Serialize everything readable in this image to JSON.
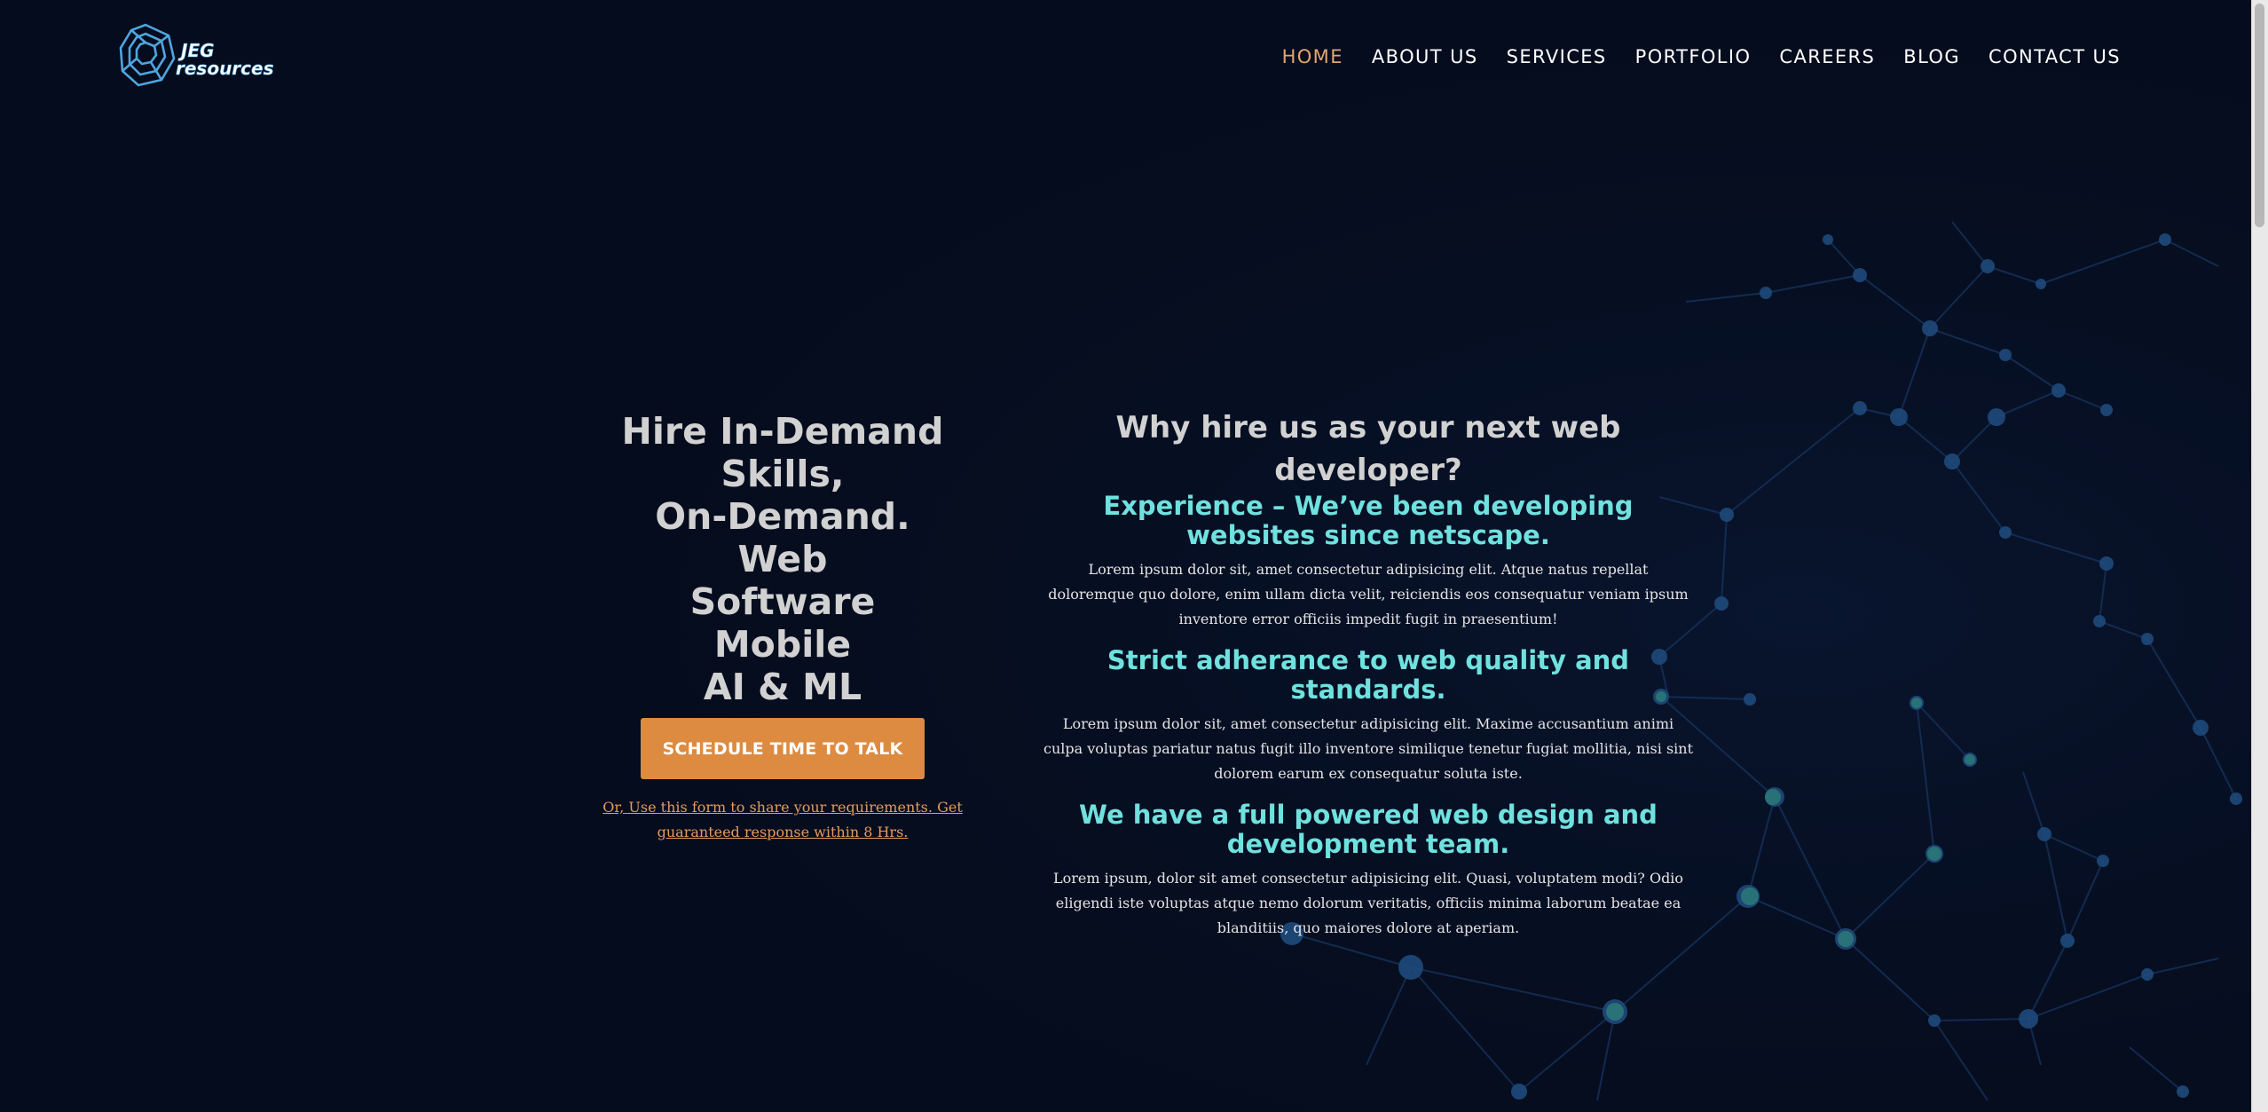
{
  "brand": {
    "logo_line1": "JEG",
    "logo_line2": "resources"
  },
  "nav": {
    "items": [
      "HOME",
      "ABOUT US",
      "SERVICES",
      "PORTFOLIO",
      "CAREERS",
      "BLOG",
      "CONTACT US"
    ],
    "active_item": "HOME"
  },
  "hero": {
    "headline": [
      "Hire In-Demand Skills,",
      "On-Demand.",
      "Web",
      "Software",
      "Mobile",
      "AI & ML"
    ],
    "cta_label": "SCHEDULE TIME TO TALK",
    "form_link": "Or, Use this form to share your requirements. Get guaranteed response within 8 Hrs."
  },
  "why": {
    "title": "Why hire us as your next web developer?",
    "features": [
      {
        "title": "Experience – We’ve been developing websites since netscape.",
        "text": "Lorem ipsum dolor sit, amet consectetur adipisicing elit. Atque natus repellat doloremque quo dolore, enim ullam dicta velit, reiciendis eos consequatur veniam ipsum inventore error officiis impedit fugit in praesentium!"
      },
      {
        "title": "Strict adherance to web quality and standards.",
        "text": "Lorem ipsum dolor sit, amet consectetur adipisicing elit. Maxime accusantium animi culpa voluptas pariatur natus fugit illo inventore similique tenetur fugiat mollitia, nisi sint dolorem earum ex consequatur soluta iste."
      },
      {
        "title": "We have a full powered web design and development team.",
        "text": "Lorem ipsum, dolor sit amet consectetur adipisicing elit. Quasi, voluptatem modi? Odio eligendi iste voluptas atque nemo dolorum veritatis, officiis minima laborum beatae ea blanditiis, quo maiores dolore at aperiam."
      }
    ]
  },
  "colors": {
    "background": "#050c1d",
    "accent_orange": "#dc8b40",
    "active_nav": "#e3a56e",
    "teal": "#6fe1de",
    "headline": "#d1d1d1"
  },
  "icons": {
    "logo": "hexagon-swirl-logo-icon"
  }
}
